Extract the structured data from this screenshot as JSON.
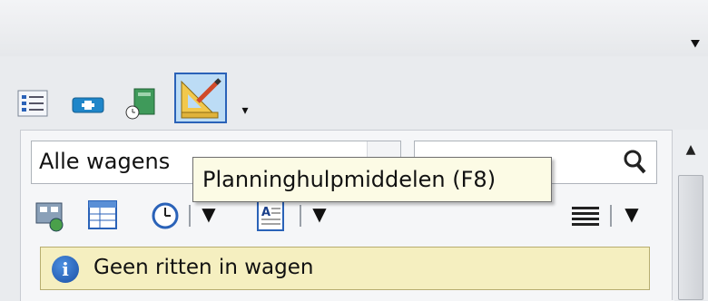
{
  "panel": {
    "menu_glyph": "⯆"
  },
  "toolbar": {
    "buttons": [
      {
        "icon": "list-checks-icon"
      },
      {
        "icon": "add-vehicle-icon"
      },
      {
        "icon": "schedule-book-icon"
      },
      {
        "icon": "planning-tools-icon",
        "active": true
      }
    ],
    "overflow_glyph": "▾"
  },
  "filter": {
    "selected": "Alle wagens"
  },
  "search": {
    "value": "",
    "icon": "search-icon"
  },
  "tooltip": {
    "text": "Planninghulpmiddelen (F8)"
  },
  "actions": {
    "icons": [
      "vehicle-group-icon",
      "grid-view-icon",
      "clock-icon",
      "text-format-icon",
      "lines-view-icon"
    ],
    "dropdown_glyph": "▼"
  },
  "info": {
    "icon_glyph": "i",
    "message": "Geen ritten in wagen"
  },
  "scroll": {
    "up_glyph": "▲"
  },
  "colors": {
    "accent": "#2a62b8",
    "info_bg": "#f5efc0",
    "tooltip_bg": "#fcfbe5"
  }
}
